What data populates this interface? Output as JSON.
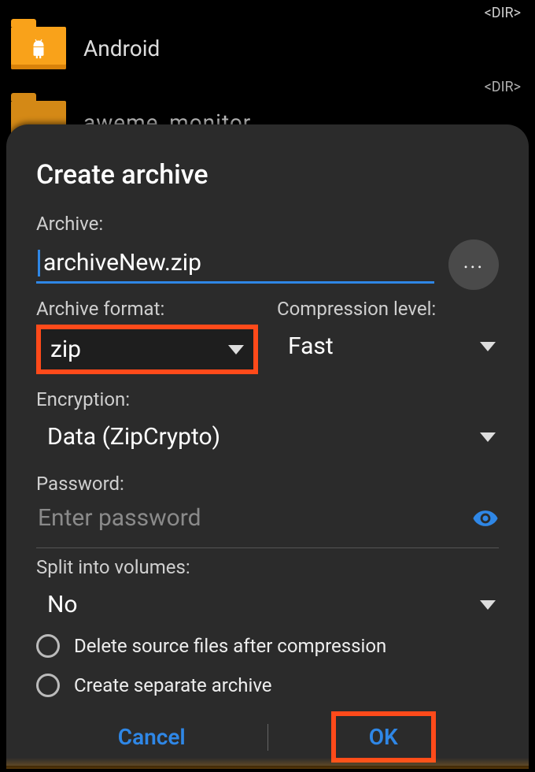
{
  "background": {
    "items": [
      {
        "name": "Android",
        "tag": "<DIR>"
      },
      {
        "name": "aweme_monitor",
        "tag": "<DIR>"
      }
    ]
  },
  "dialog": {
    "title": "Create archive",
    "archive_label": "Archive:",
    "archive_value": "archiveNew.zip",
    "browse_label": "...",
    "format": {
      "label": "Archive format:",
      "value": "zip"
    },
    "compression": {
      "label": "Compression level:",
      "value": "Fast"
    },
    "encryption": {
      "label": "Encryption:",
      "value": "Data (ZipCrypto)"
    },
    "password": {
      "label": "Password:",
      "placeholder": "Enter password"
    },
    "split": {
      "label": "Split into volumes:",
      "value": "No"
    },
    "options": {
      "delete_source": "Delete source files after compression",
      "separate_archive": "Create separate archive"
    },
    "buttons": {
      "cancel": "Cancel",
      "ok": "OK"
    }
  }
}
